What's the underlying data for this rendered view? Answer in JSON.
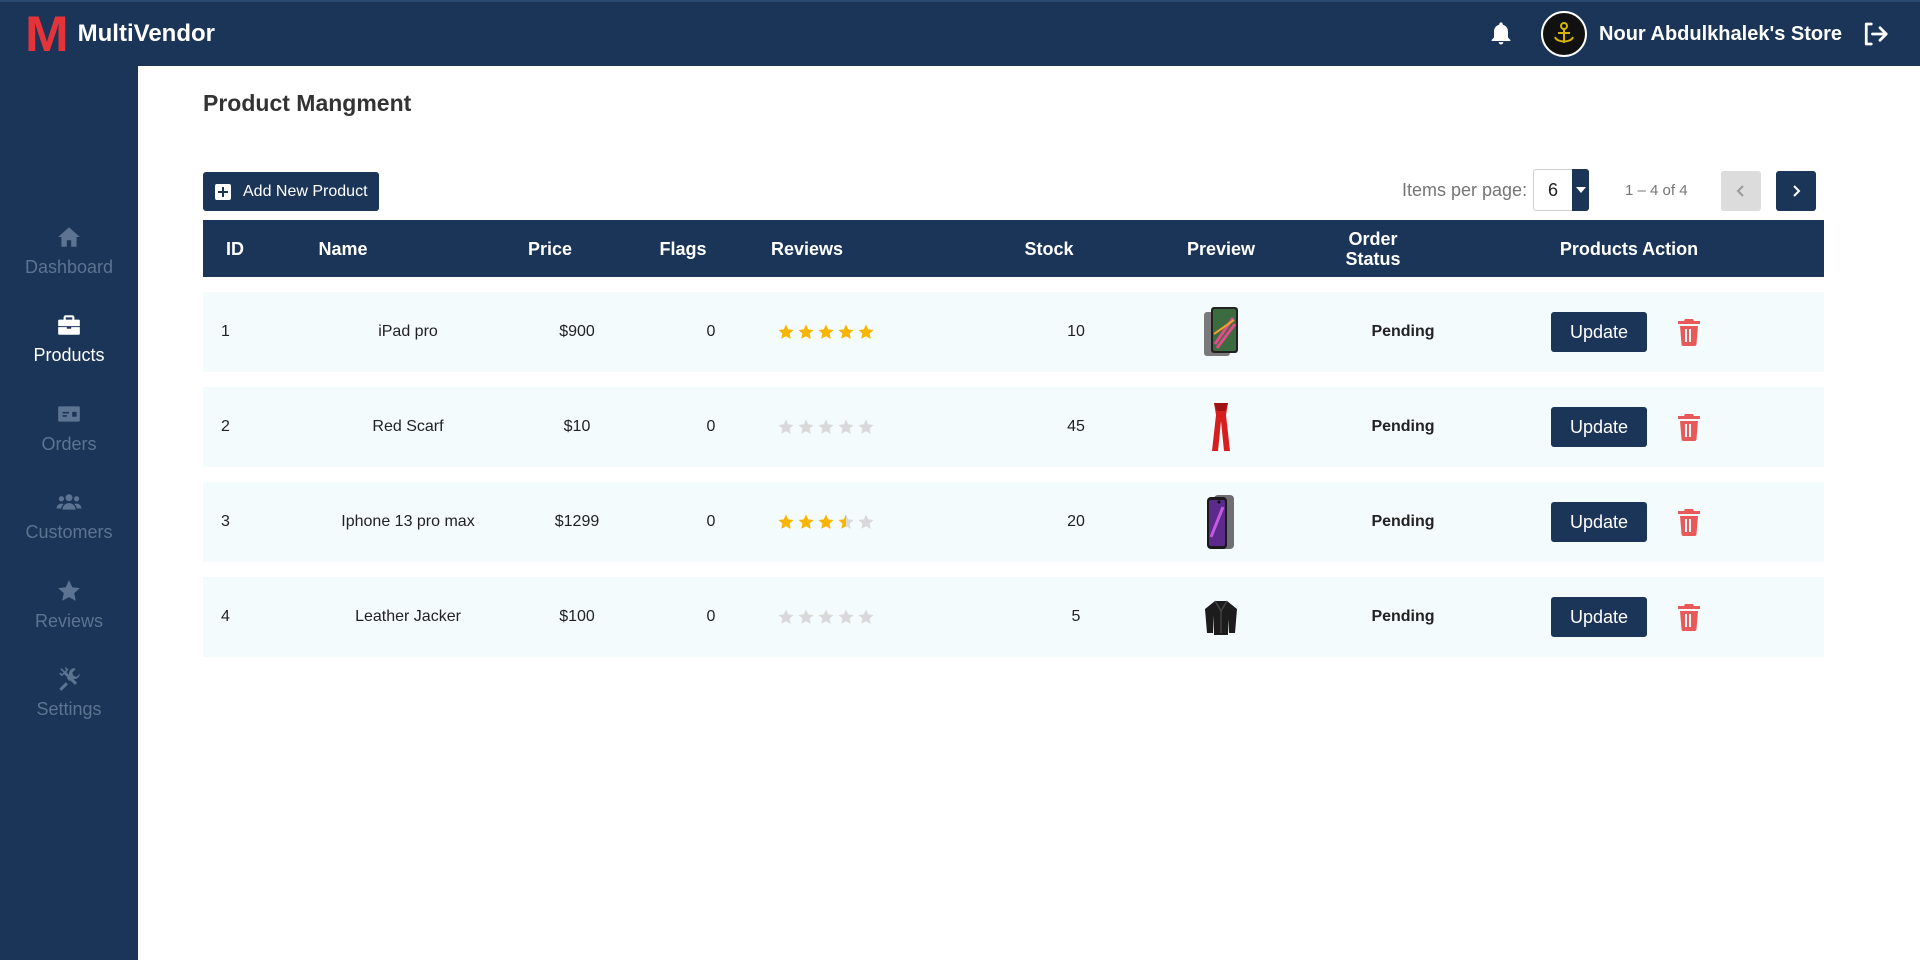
{
  "app": {
    "logo_letter": "M",
    "name": "MultiVendor"
  },
  "header": {
    "store_name": "Nour Abdulkhalek's Store"
  },
  "colors": {
    "primary": "#1b3558",
    "brand_red": "#e5333a",
    "star": "#f7b500",
    "star_empty": "#d9d9d9",
    "delete": "#e85a5a",
    "row_bg": "#f3fbfd"
  },
  "sidebar": {
    "items": [
      {
        "label": "Dashboard",
        "icon": "home-icon",
        "active": false
      },
      {
        "label": "Products",
        "icon": "briefcase-icon",
        "active": true
      },
      {
        "label": "Orders",
        "icon": "money-bill-icon",
        "active": false
      },
      {
        "label": "Customers",
        "icon": "users-icon",
        "active": false
      },
      {
        "label": "Reviews",
        "icon": "star-icon",
        "active": false
      },
      {
        "label": "Settings",
        "icon": "tools-icon",
        "active": false
      }
    ]
  },
  "page": {
    "title": "Product Mangment",
    "add_button": "Add New Product"
  },
  "pagination": {
    "label": "Items per page:",
    "value": "6",
    "range": "1 – 4 of 4"
  },
  "table": {
    "headers": {
      "id": "ID",
      "name": "Name",
      "price": "Price",
      "flags": "Flags",
      "reviews": "Reviews",
      "stock": "Stock",
      "preview": "Preview",
      "status_line1": "Order",
      "status_line2": "Status",
      "actions": "Products Action"
    },
    "update_label": "Update",
    "rows": [
      {
        "id": "1",
        "name": "iPad pro",
        "price": "$900",
        "flags": "0",
        "rating": 5,
        "stock": "10",
        "preview": "ipad-image",
        "status": "Pending"
      },
      {
        "id": "2",
        "name": "Red Scarf",
        "price": "$10",
        "flags": "0",
        "rating": 0,
        "stock": "45",
        "preview": "scarf-image",
        "status": "Pending"
      },
      {
        "id": "3",
        "name": "Iphone 13 pro max",
        "price": "$1299",
        "flags": "0",
        "rating": 3.5,
        "stock": "20",
        "preview": "iphone-image",
        "status": "Pending"
      },
      {
        "id": "4",
        "name": "Leather Jacker",
        "price": "$100",
        "flags": "0",
        "rating": 0,
        "stock": "5",
        "preview": "jacket-image",
        "status": "Pending"
      }
    ]
  }
}
